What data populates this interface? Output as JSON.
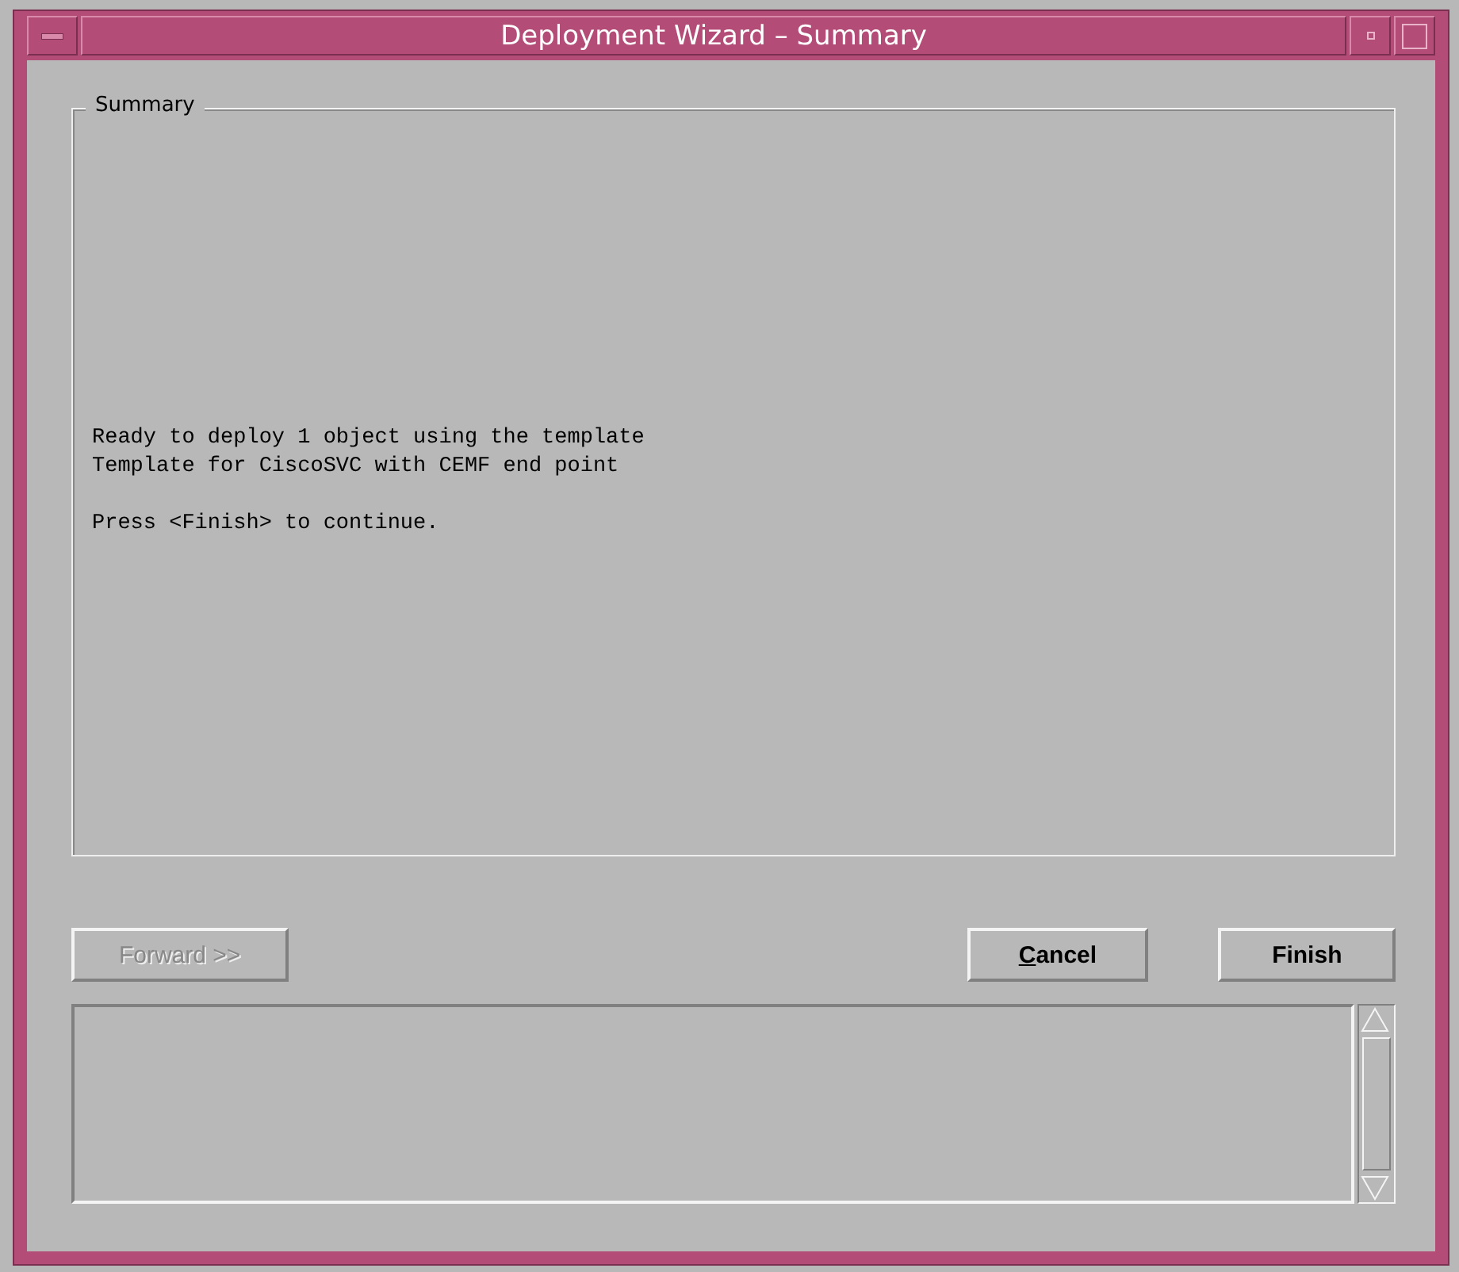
{
  "window": {
    "title": "Deployment Wizard – Summary"
  },
  "summary": {
    "label": "Summary",
    "paragraphs": [
      [
        "Ready to deploy 1 object using the template",
        "Template for CiscoSVC with CEMF end point"
      ],
      [
        "Press <Finish> to continue."
      ]
    ]
  },
  "buttons": [
    {
      "label": "Forward >>",
      "disabled": true,
      "mnemonic": false
    },
    {
      "label": "Cancel",
      "disabled": false,
      "mnemonic": true
    },
    {
      "label": "Finish",
      "disabled": false,
      "mnemonic": false
    }
  ]
}
